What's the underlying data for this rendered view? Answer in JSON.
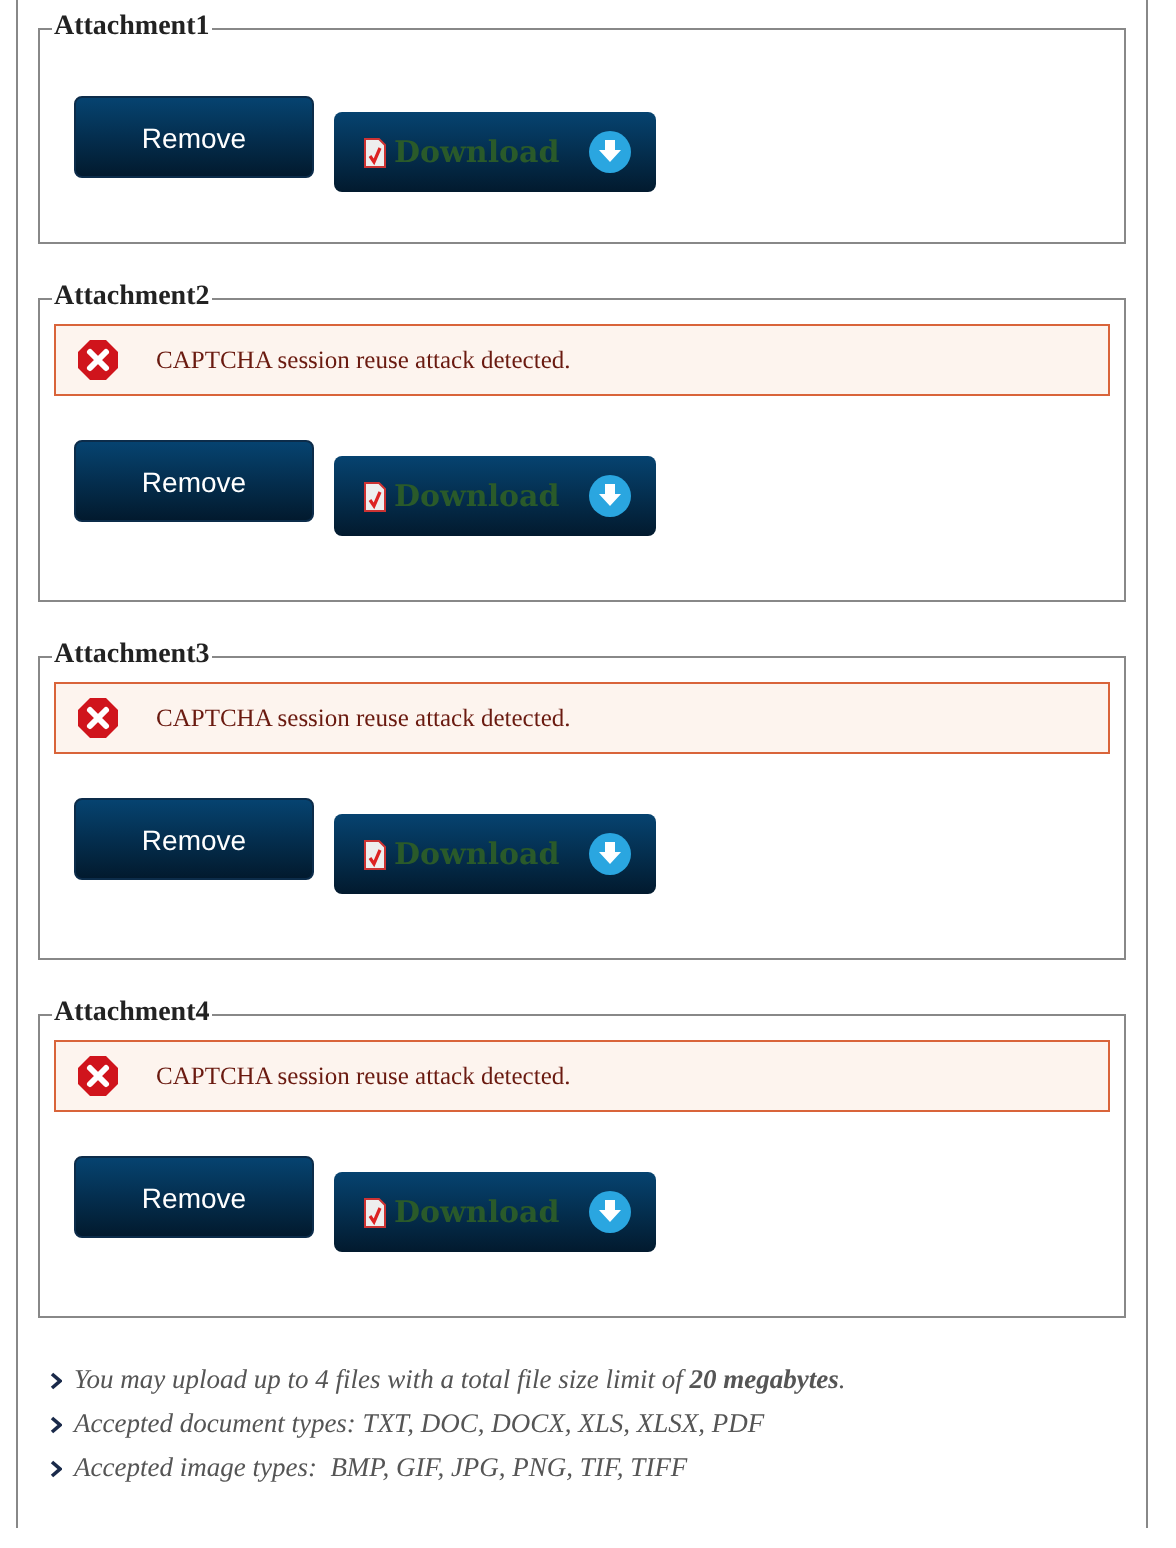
{
  "attachments": [
    {
      "legend": "Attachment1",
      "remove": "Remove",
      "download": "Download"
    },
    {
      "legend": "Attachment2",
      "error": "CAPTCHA session reuse attack detected.",
      "remove": "Remove",
      "download": "Download"
    },
    {
      "legend": "Attachment3",
      "error": "CAPTCHA session reuse attack detected.",
      "remove": "Remove",
      "download": "Download"
    },
    {
      "legend": "Attachment4",
      "error": "CAPTCHA session reuse attack detected.",
      "remove": "Remove",
      "download": "Download"
    }
  ],
  "notes": [
    "You may upload up to 4 files with a total file size limit of **20 megabytes**.",
    "Accepted document types: TXT, DOC, DOCX, XLS, XLSX, PDF",
    "Accepted image types:  BMP, GIF, JPG, PNG, TIF, TIFF"
  ]
}
